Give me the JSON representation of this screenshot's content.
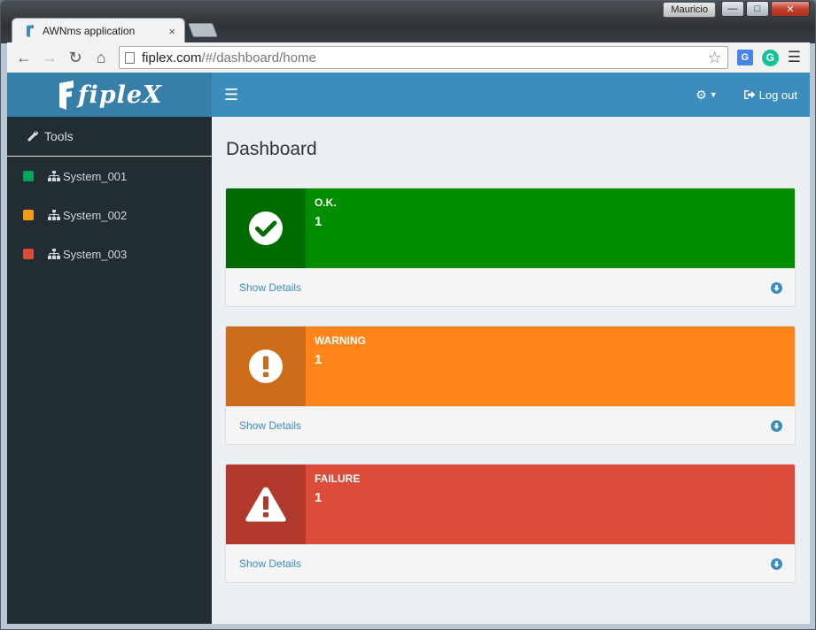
{
  "os": {
    "user": "Mauricio"
  },
  "browser": {
    "tab_title": "AWNms application",
    "url_host": "fiplex.com",
    "url_path": "/#/dashboard/home",
    "close_glyph": "×"
  },
  "app": {
    "logo_text": "fipleX",
    "header": {
      "logout_label": "Log out"
    },
    "sidebar": {
      "tools_label": "Tools",
      "systems": [
        {
          "label": "System_001",
          "status_color": "#00a65a"
        },
        {
          "label": "System_002",
          "status_color": "#f39c12"
        },
        {
          "label": "System_003",
          "status_color": "#dd4b39"
        }
      ]
    },
    "page_title": "Dashboard",
    "panels": [
      {
        "label": "O.K.",
        "count": "1",
        "footer": "Show Details",
        "icon": "check-circle-icon",
        "color": "#008d00"
      },
      {
        "label": "WARNING",
        "count": "1",
        "footer": "Show Details",
        "icon": "exclamation-circle-icon",
        "color": "#ff851b"
      },
      {
        "label": "FAILURE",
        "count": "1",
        "footer": "Show Details",
        "icon": "warning-triangle-icon",
        "color": "#dd4b39"
      }
    ]
  }
}
